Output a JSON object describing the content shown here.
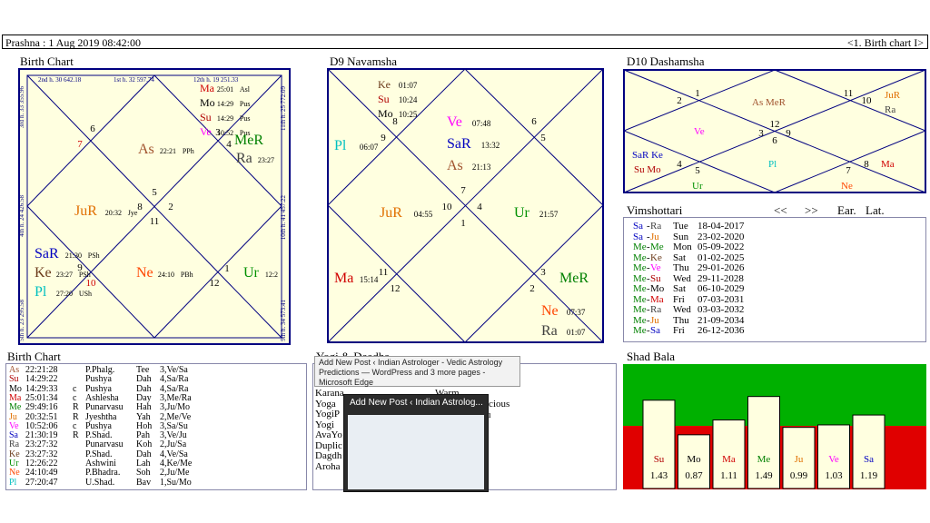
{
  "header": {
    "left": "Prashna :   1 Aug 2019  08:42:00",
    "right": "<1. Birth chart I>"
  },
  "titles": {
    "birth_chart": "Birth Chart",
    "navamsha": "D9 Navamsha",
    "dashamsha": "D10 Dashamsha",
    "vimshottari": "Vimshottari",
    "birth_table": "Birth Chart",
    "yogi": "Yogi & Daadha",
    "shad_bala": "Shad Bala"
  },
  "vim_controls": {
    "prev": "<<",
    "next": ">>",
    "ear": "Ear.",
    "lat": "Lat."
  },
  "colors": {
    "As": "#a0522d",
    "Su": "#b00000",
    "Mo": "#000000",
    "Ma": "#d00000",
    "Me": "#008000",
    "Ju": "#e07000",
    "Ve": "#ff00ff",
    "Sa": "#0000c0",
    "Ra": "#404040",
    "Ke": "#6b3a1a",
    "Ur": "#009000",
    "Ne": "#ff4500",
    "Pl": "#00c0c0",
    "frame": "#000080",
    "chart_bg": "#ffffe0"
  },
  "birth_chart": {
    "houses_labels": [
      "2nd h. 30  642.18",
      "1st h. 32  597.74",
      "12th h. 19  251.33",
      "11th h. 25  772.09",
      "10th h. 41  457.22",
      "9th h. 34  573.41",
      "8th h. 27  430.88",
      "7th h. 26  364.88",
      "6th h. 23  365.34",
      "5th h. 23  295.58",
      "4th h. 24  426.58",
      "3rd h. 33  355.96"
    ],
    "house_numbers": [
      "6",
      "7",
      "5",
      "8",
      "2",
      "11",
      "9",
      "10",
      "1",
      "12",
      "4",
      "3"
    ],
    "planets": [
      {
        "abbr": "Ma",
        "deg": "25:01",
        "nak": "Asl"
      },
      {
        "abbr": "Mo",
        "deg": "14:29",
        "nak": "Pus"
      },
      {
        "abbr": "Su",
        "deg": "14:29",
        "nak": "Pus"
      },
      {
        "abbr": "Ve",
        "deg": "10:52",
        "nak": "Pus"
      },
      {
        "abbr": "MeR",
        "deg": "",
        "nak": ""
      },
      {
        "abbr": "Ra",
        "deg": "23:27",
        "nak": ""
      },
      {
        "abbr": "As",
        "deg": "22:21",
        "nak": "PPh"
      },
      {
        "abbr": "JuR",
        "deg": "20:32",
        "nak": "Jye"
      },
      {
        "abbr": "SaR",
        "deg": "21:30",
        "nak": "PSh"
      },
      {
        "abbr": "Ke",
        "deg": "23:27",
        "nak": "PSh"
      },
      {
        "abbr": "Pl",
        "deg": "27:20",
        "nak": "USh"
      },
      {
        "abbr": "Ne",
        "deg": "24:10",
        "nak": "PBh"
      },
      {
        "abbr": "Ur",
        "deg": "12:2",
        "nak": ""
      }
    ]
  },
  "navamsha": {
    "house_numbers": [
      "8",
      "9",
      "6",
      "5",
      "7",
      "10",
      "4",
      "1",
      "11",
      "12",
      "3",
      "2"
    ],
    "planets": [
      {
        "abbr": "Ke",
        "deg": "01:07"
      },
      {
        "abbr": "Su",
        "deg": "10:24"
      },
      {
        "abbr": "Mo",
        "deg": "10:25"
      },
      {
        "abbr": "Pl",
        "deg": "06:07"
      },
      {
        "abbr": "Ve",
        "deg": "07:48"
      },
      {
        "abbr": "SaR",
        "deg": "13:32"
      },
      {
        "abbr": "As",
        "deg": "21:13"
      },
      {
        "abbr": "JuR",
        "deg": "04:55"
      },
      {
        "abbr": "Ur",
        "deg": "21:57"
      },
      {
        "abbr": "Ma",
        "deg": "15:14"
      },
      {
        "abbr": "MeR",
        "deg": ""
      },
      {
        "abbr": "Ne",
        "deg": "07:37"
      },
      {
        "abbr": "Ra",
        "deg": "01:07"
      }
    ]
  },
  "dashamsha": {
    "house_numbers": [
      "2",
      "1",
      "11",
      "10",
      "12",
      "3",
      "9",
      "6",
      "4",
      "5",
      "7",
      "8"
    ],
    "planets": [
      "As MeR",
      "JuR",
      "Ra",
      "Ve",
      "SaR Ke",
      "Su Mo",
      "Pl",
      "Ma",
      "Ur",
      "Ne"
    ]
  },
  "vimshottari": [
    {
      "p1": "Sa",
      "p2": "Ra",
      "day": "Tue",
      "date": "18-04-2017"
    },
    {
      "p1": "Sa",
      "p2": "Ju",
      "day": "Sun",
      "date": "23-02-2020"
    },
    {
      "p1": "Me",
      "p2": "Me",
      "day": "Mon",
      "date": "05-09-2022"
    },
    {
      "p1": "Me",
      "p2": "Ke",
      "day": "Sat",
      "date": "01-02-2025"
    },
    {
      "p1": "Me",
      "p2": "Ve",
      "day": "Thu",
      "date": "29-01-2026"
    },
    {
      "p1": "Me",
      "p2": "Su",
      "day": "Wed",
      "date": "29-11-2028"
    },
    {
      "p1": "Me",
      "p2": "Mo",
      "day": "Sat",
      "date": "06-10-2029"
    },
    {
      "p1": "Me",
      "p2": "Ma",
      "day": "Fri",
      "date": "07-03-2031"
    },
    {
      "p1": "Me",
      "p2": "Ra",
      "day": "Wed",
      "date": "03-03-2032"
    },
    {
      "p1": "Me",
      "p2": "Ju",
      "day": "Thu",
      "date": "21-09-2034"
    },
    {
      "p1": "Me",
      "p2": "Sa",
      "day": "Fri",
      "date": "26-12-2036"
    }
  ],
  "birth_table": [
    {
      "p": "As",
      "deg": "22:21:28",
      "r": "",
      "nak": "P.Phalg.",
      "code": "Tee",
      "pada": "3,Ve/Sa"
    },
    {
      "p": "Su",
      "deg": "14:29:22",
      "r": "",
      "nak": "Pushya",
      "code": "Dah",
      "pada": "4,Sa/Ra"
    },
    {
      "p": "Mo",
      "deg": "14:29:33",
      "r": "c",
      "nak": "Pushya",
      "code": "Dah",
      "pada": "4,Sa/Ra"
    },
    {
      "p": "Ma",
      "deg": "25:01:34",
      "r": "c",
      "nak": "Ashlesha",
      "code": "Day",
      "pada": "3,Me/Ra"
    },
    {
      "p": "Me",
      "deg": "29:49:16",
      "r": "R",
      "nak": "Punarvasu",
      "code": "Hah",
      "pada": "3,Ju/Mo"
    },
    {
      "p": "Ju",
      "deg": "20:32:51",
      "r": "R",
      "nak": "Jyeshtha",
      "code": "Yah",
      "pada": "2,Me/Ve"
    },
    {
      "p": "Ve",
      "deg": "10:52:06",
      "r": "c",
      "nak": "Pushya",
      "code": "Hoh",
      "pada": "3,Sa/Su"
    },
    {
      "p": "Sa",
      "deg": "21:30:19",
      "r": "R",
      "nak": "P.Shad.",
      "code": "Pah",
      "pada": "3,Ve/Ju"
    },
    {
      "p": "Ra",
      "deg": "23:27:32",
      "r": "",
      "nak": "Punarvasu",
      "code": "Koh",
      "pada": "2,Ju/Sa"
    },
    {
      "p": "Ke",
      "deg": "23:27:32",
      "r": "",
      "nak": "P.Shad.",
      "code": "Dah",
      "pada": "4,Ve/Sa"
    },
    {
      "p": "Ur",
      "deg": "12:26:22",
      "r": "",
      "nak": "Ashwini",
      "code": "Lah",
      "pada": "4,Ke/Me"
    },
    {
      "p": "Ne",
      "deg": "24:10:49",
      "r": "",
      "nak": "P.Bhadra.",
      "code": "Soh",
      "pada": "2,Ju/Me"
    },
    {
      "p": "Pl",
      "deg": "27:20:47",
      "r": "",
      "nak": "U.Shad.",
      "code": "Bav",
      "pada": "1,Su/Mo"
    }
  ],
  "yogi": {
    "labels": [
      "Karana",
      "Yoga",
      "YogiP",
      "Yogi",
      "AvaYo",
      "Duplic",
      "Dagdh",
      "Aroha"
    ],
    "partial": [
      "Warm",
      "icious",
      "u"
    ]
  },
  "shad_bala": [
    {
      "p": "Su",
      "v": 1.43
    },
    {
      "p": "Mo",
      "v": 0.87
    },
    {
      "p": "Ma",
      "v": 1.11
    },
    {
      "p": "Me",
      "v": 1.49
    },
    {
      "p": "Ju",
      "v": 0.99
    },
    {
      "p": "Ve",
      "v": 1.03
    },
    {
      "p": "Sa",
      "v": 1.19
    }
  ],
  "shad_bala_labels": [
    "1.43",
    "0.87",
    "1.11",
    "1.49",
    "0.99",
    "1.03",
    "1.19"
  ],
  "taskbar": {
    "tooltip": "Add New Post ‹ Indian Astrologer - Vedic Astrology Predictions — WordPress and 3 more pages - Microsoft Edge",
    "thumb_title": "Add New Post ‹ Indian Astrolog..."
  }
}
